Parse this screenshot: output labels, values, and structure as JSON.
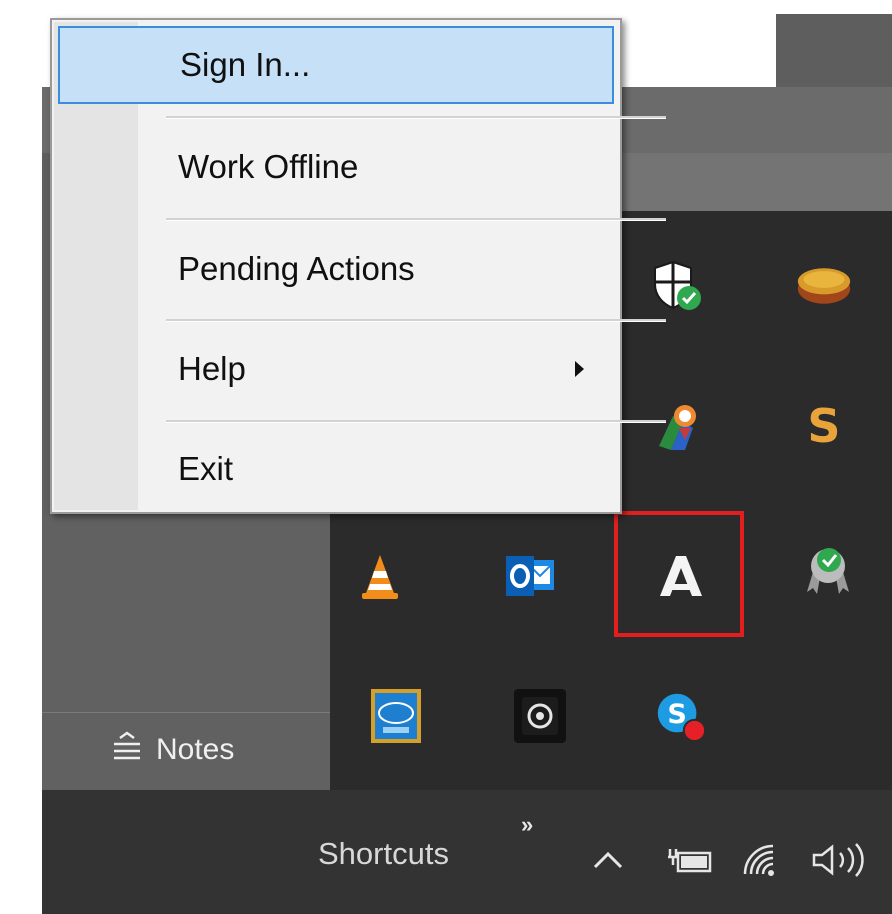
{
  "context_menu": {
    "items": [
      {
        "label": "Sign In...",
        "selected": true,
        "has_submenu": false
      },
      {
        "label": "Work Offline",
        "selected": false,
        "has_submenu": false
      },
      {
        "label": "Pending Actions",
        "selected": false,
        "has_submenu": false
      },
      {
        "label": "Help",
        "selected": false,
        "has_submenu": true
      },
      {
        "label": "Exit",
        "selected": false,
        "has_submenu": false
      }
    ]
  },
  "notes_button": {
    "label": "Notes",
    "icon": "notes-icon"
  },
  "tray_overflow": {
    "icons": [
      "windows-defender-shield-icon",
      "disk-app-icon",
      "certificate-app-icon",
      "s-app-icon",
      "vlc-cone-icon",
      "outlook-icon",
      "autodesk-a-icon",
      "award-check-icon",
      "intel-app-icon",
      "webcam-app-icon",
      "skype-icon"
    ],
    "highlighted_icon": "autodesk-a-icon",
    "highlight_color": "#e21e1e"
  },
  "taskbar": {
    "shortcuts_label": "Shortcuts",
    "chevron_label": "»",
    "tray_icons": [
      "show-hidden-icons-chevron-icon",
      "battery-icon",
      "wifi-icon",
      "volume-icon"
    ]
  },
  "colors": {
    "menu_selected_bg": "#c5e0f7",
    "menu_selected_border": "#3c8ddb",
    "taskbar_bg": "#333333",
    "tray_bg": "#2b2b2b"
  }
}
